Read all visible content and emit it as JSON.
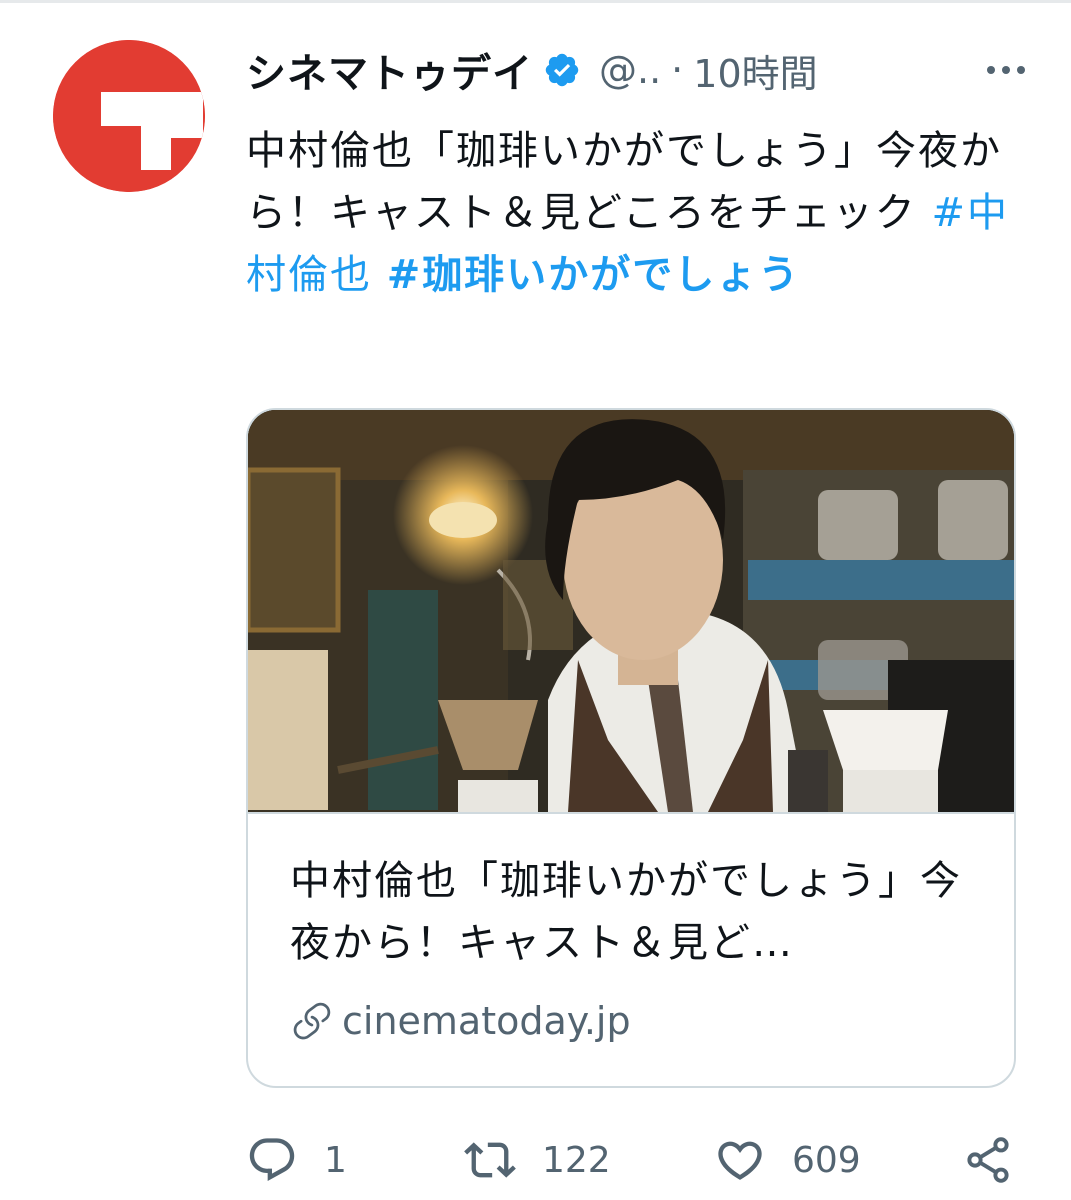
{
  "account": {
    "name": "シネマトゥデイ",
    "handle": "@..",
    "separator": "·",
    "time": "10時間",
    "verified": true,
    "avatar_color": "#e23c32"
  },
  "tweet": {
    "text": "中村倫也「珈琲いかがでしょう」今夜から！キャスト＆見どころをチェック ",
    "hashtag1": "#中村倫也",
    "hashtag2": "#珈琲いかがでしょう"
  },
  "card": {
    "image": "barista-in-cafe-photo",
    "title": "中村倫也「珈琲いかがでしょう」今夜から！キャスト＆見ど…",
    "domain": "cinematoday.jp"
  },
  "actions": {
    "reply": {
      "icon": "reply-icon",
      "count": "1"
    },
    "retweet": {
      "icon": "retweet-icon",
      "count": "122"
    },
    "like": {
      "icon": "like-icon",
      "count": "609"
    },
    "share": {
      "icon": "share-icon"
    }
  },
  "colors": {
    "link": "#1d9bf0",
    "secondary_text": "#536471",
    "border": "#cfd9de"
  }
}
